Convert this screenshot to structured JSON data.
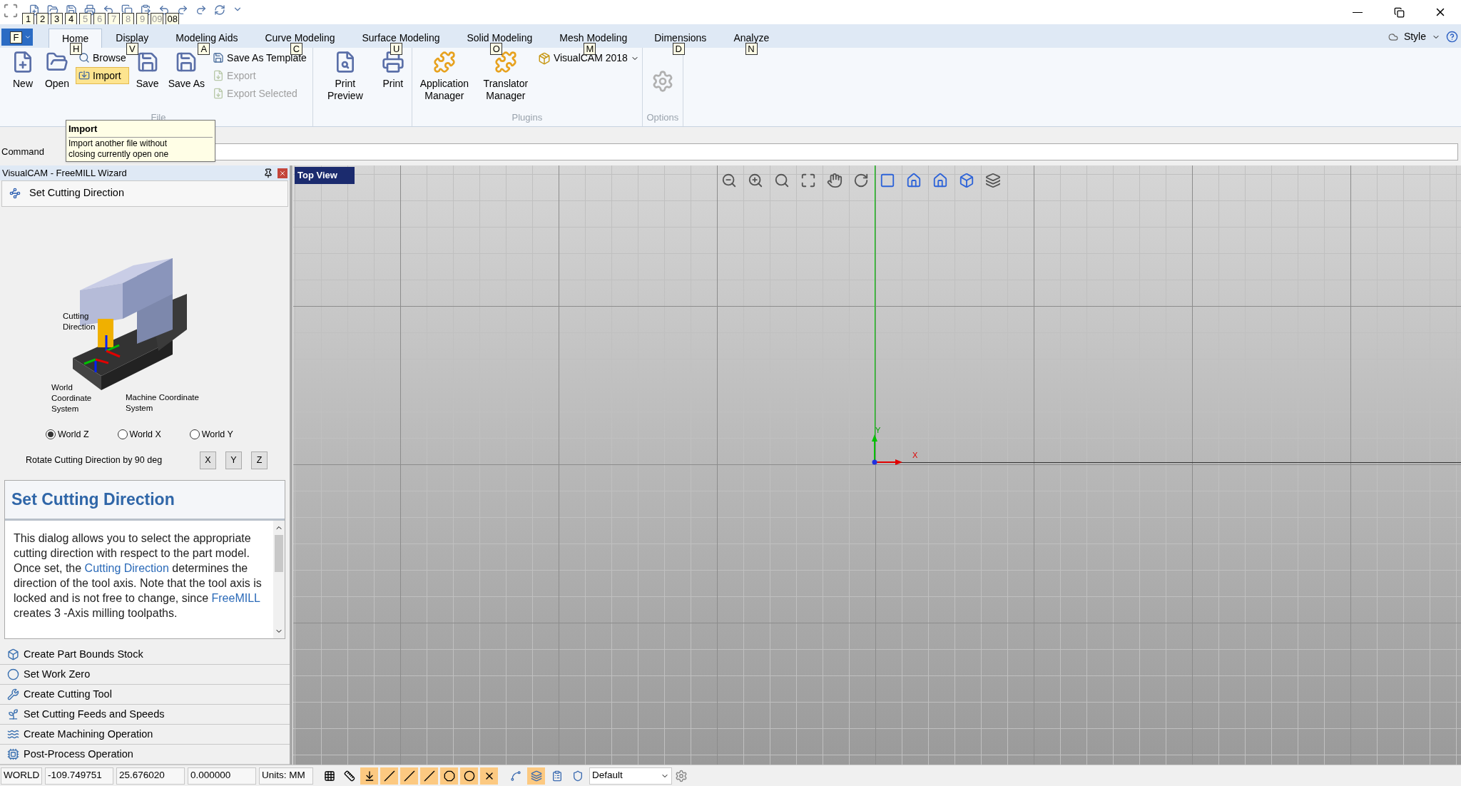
{
  "quick_access": {
    "keytips": [
      {
        "label": "1",
        "disabled": false
      },
      {
        "label": "2",
        "disabled": false
      },
      {
        "label": "3",
        "disabled": false
      },
      {
        "label": "4",
        "disabled": false
      },
      {
        "label": "5",
        "disabled": true
      },
      {
        "label": "6",
        "disabled": true
      },
      {
        "label": "7",
        "disabled": true
      },
      {
        "label": "8",
        "disabled": true
      },
      {
        "label": "9",
        "disabled": true
      },
      {
        "label": "09",
        "disabled": true
      },
      {
        "label": "08",
        "disabled": false
      }
    ]
  },
  "window": {
    "style_menu": "Style"
  },
  "file_button": {
    "keytip": "F"
  },
  "tabs": [
    {
      "label": "Home",
      "keytip": "H",
      "selected": true
    },
    {
      "label": "Display",
      "keytip": "V",
      "selected": false
    },
    {
      "label": "Modeling Aids",
      "keytip": "A",
      "selected": false
    },
    {
      "label": "Curve Modeling",
      "keytip": "C",
      "selected": false
    },
    {
      "label": "Surface Modeling",
      "keytip": "U",
      "selected": false
    },
    {
      "label": "Solid Modeling",
      "keytip": "O",
      "selected": false
    },
    {
      "label": "Mesh Modeling",
      "keytip": "M",
      "selected": false
    },
    {
      "label": "Dimensions",
      "keytip": "D",
      "selected": false
    },
    {
      "label": "Analyze",
      "keytip": "N",
      "selected": false
    }
  ],
  "ribbon_groups": [
    {
      "label": "File",
      "items": [
        {
          "kind": "large",
          "label": "New",
          "disabled": false
        },
        {
          "kind": "large",
          "label": "Open",
          "disabled": false
        },
        {
          "kind": "small",
          "label": "Browse",
          "disabled": false,
          "highlighted": false
        },
        {
          "kind": "small",
          "label": "Import",
          "disabled": false,
          "highlighted": true
        },
        {
          "kind": "large",
          "label": "Save",
          "disabled": false
        },
        {
          "kind": "large",
          "label": "Save As",
          "disabled": false
        },
        {
          "kind": "small",
          "label": "Save As Template",
          "disabled": false,
          "highlighted": false
        },
        {
          "kind": "small",
          "label": "Export",
          "disabled": true,
          "highlighted": false
        },
        {
          "kind": "small",
          "label": "Export Selected",
          "disabled": true,
          "highlighted": false
        }
      ]
    },
    {
      "items": [
        {
          "kind": "large",
          "label": "Print Preview",
          "disabled": false
        },
        {
          "kind": "large",
          "label": "Print",
          "disabled": false
        }
      ]
    },
    {
      "label": "Plugins",
      "items": [
        {
          "kind": "large",
          "label": "Application Manager",
          "disabled": false
        },
        {
          "kind": "large",
          "label": "Translator Manager",
          "disabled": false
        },
        {
          "kind": "dropdown",
          "label": "VisualCAM 2018"
        }
      ]
    },
    {
      "label": "Options",
      "items": [
        {
          "kind": "icon",
          "disabled": true
        }
      ]
    }
  ],
  "tooltip": {
    "title": "Import",
    "text": "Import another file without closing currently open one"
  },
  "command_bar": {
    "label": "Command"
  },
  "wizard": {
    "title": "VisualCAM - FreeMILL Wizard",
    "current_step": "Set Cutting Direction",
    "illustration_labels": [
      "Cutting Direction",
      "World Coordinate System",
      "Machine Coordinate System"
    ],
    "radios": [
      {
        "label": "World Z",
        "selected": true
      },
      {
        "label": "World X",
        "selected": false
      },
      {
        "label": "World Y",
        "selected": false
      }
    ],
    "rotate_label": "Rotate Cutting Direction by 90 deg",
    "rotate_buttons": [
      "X",
      "Y",
      "Z"
    ],
    "help_title": "Set Cutting Direction",
    "help_body": [
      {
        "kind": "text",
        "text": "This dialog allows you to select the appropriate cutting direction with respect to the part model.  Once set, the "
      },
      {
        "kind": "link",
        "text": "Cutting Direction"
      },
      {
        "kind": "text",
        "text": " determines the direction of the tool axis.  Note that the tool axis is locked and is not free to change, since "
      },
      {
        "kind": "link",
        "text": "FreeMILL"
      },
      {
        "kind": "text",
        "text": " creates 3 -Axis milling toolpaths."
      }
    ],
    "steps": [
      "Create Part Bounds Stock",
      "Set Work Zero",
      "Create Cutting Tool",
      "Set Cutting Feeds and Speeds",
      "Create Machining Operation",
      "Post-Process Operation"
    ]
  },
  "viewport": {
    "view_label": "Top View",
    "axis_x": "X",
    "axis_y": "Y"
  },
  "status_bar": {
    "fields": [
      "WORLD",
      "-109.749751",
      "25.676020",
      "0.000000",
      "Units: MM"
    ],
    "snaps": [
      {
        "on": false
      },
      {
        "on": false
      },
      {
        "on": true
      },
      {
        "on": true
      },
      {
        "on": true
      },
      {
        "on": true
      },
      {
        "on": true
      },
      {
        "on": true
      },
      {
        "on": true
      }
    ],
    "tools": [
      {
        "on": false
      },
      {
        "on": true
      },
      {
        "on": false
      },
      {
        "on": false
      }
    ],
    "layer": "Default"
  }
}
